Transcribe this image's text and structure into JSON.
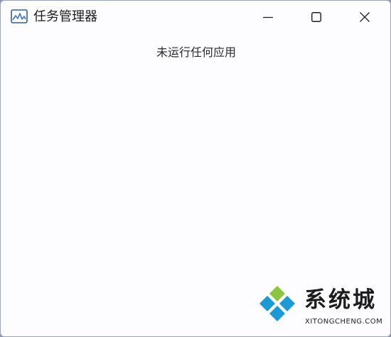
{
  "window": {
    "title": "任务管理器",
    "icon": "task-manager-icon",
    "controls": {
      "minimize": "minimize-icon",
      "maximize": "maximize-icon",
      "close": "close-icon"
    }
  },
  "main": {
    "empty_message": "未运行任何应用"
  },
  "watermark": {
    "text_cn": "系统城",
    "text_en": "XITONGCHENG.COM",
    "colors": {
      "green": "#8cc63f",
      "blue": "#1b9ad6"
    }
  },
  "colors": {
    "background": "#fdfcfe",
    "text": "#1b1b1b",
    "icon_blue": "#3c78c8"
  }
}
